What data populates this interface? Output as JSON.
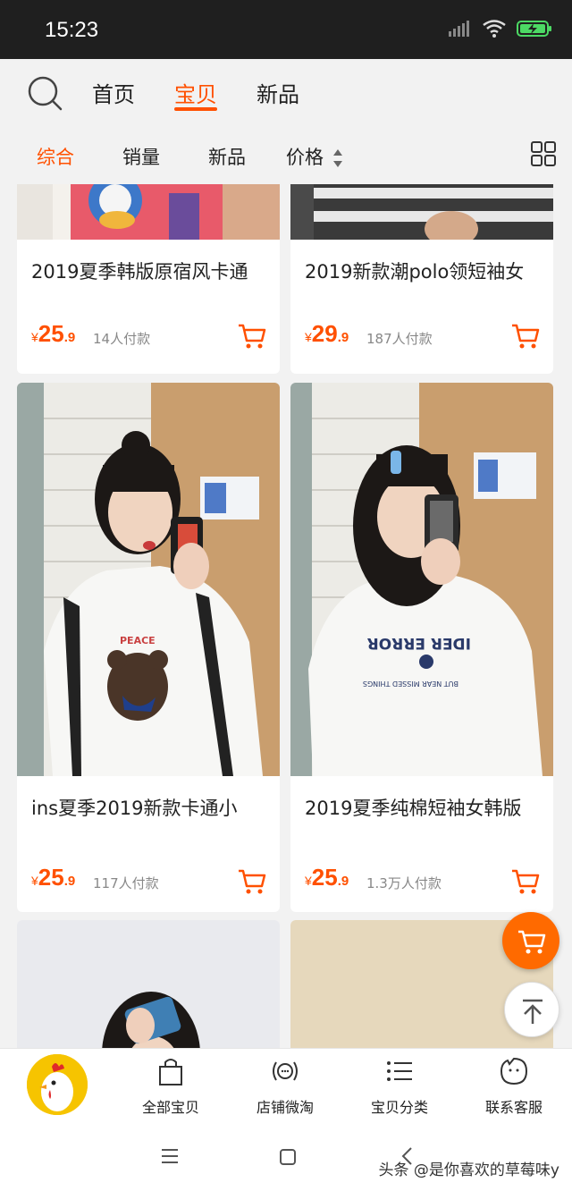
{
  "status_bar": {
    "time": "15:23"
  },
  "top_nav": {
    "tabs": [
      "首页",
      "宝贝",
      "新品"
    ],
    "active_tab": "宝贝"
  },
  "sort_bar": {
    "items": [
      "综合",
      "销量",
      "新品",
      "价格"
    ],
    "active": "综合"
  },
  "products": [
    {
      "title": "2019夏季韩版原宿风卡通",
      "currency": "¥",
      "price_int": "25",
      "price_dec": ".9",
      "sales": "14人付款"
    },
    {
      "title": "2019新款潮polo领短袖女",
      "currency": "¥",
      "price_int": "29",
      "price_dec": ".9",
      "sales": "187人付款"
    },
    {
      "title": "ins夏季2019新款卡通小",
      "currency": "¥",
      "price_int": "25",
      "price_dec": ".9",
      "sales": "117人付款"
    },
    {
      "title": "2019夏季纯棉短袖女韩版",
      "currency": "¥",
      "price_int": "25",
      "price_dec": ".9",
      "sales": "1.3万人付款"
    }
  ],
  "bottom_nav": {
    "items": [
      {
        "label": "全部宝贝",
        "icon": "shopping-bag-icon"
      },
      {
        "label": "店铺微淘",
        "icon": "broadcast-icon"
      },
      {
        "label": "宝贝分类",
        "icon": "list-icon"
      },
      {
        "label": "联系客服",
        "icon": "chat-face-icon"
      }
    ]
  },
  "watermark": "头条 @是你喜欢的草莓味y",
  "colors": {
    "accent": "#ff5000",
    "float_button": "#ff6a00",
    "status_bar": "#1f1f1f",
    "background": "#f2f2f2"
  }
}
